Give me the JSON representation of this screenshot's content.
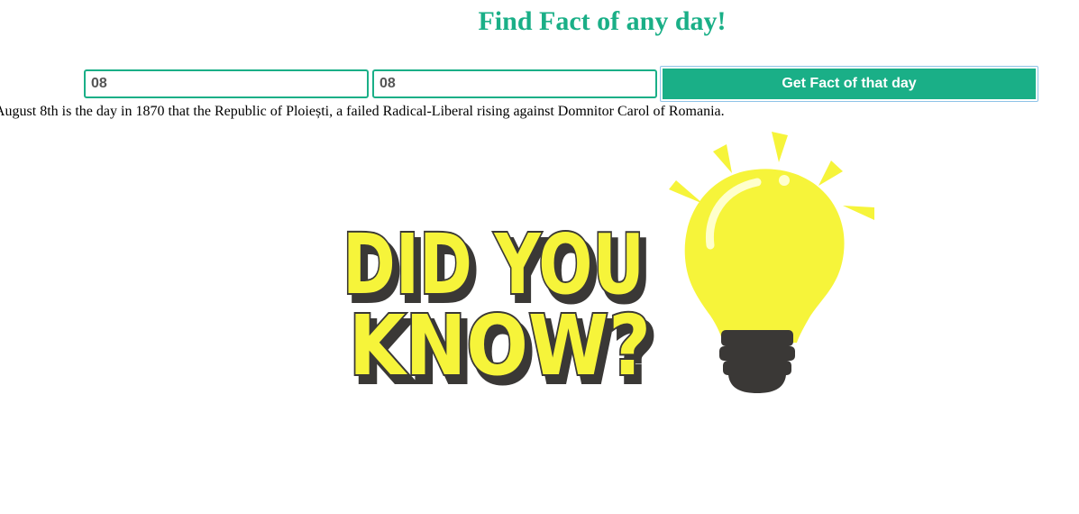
{
  "header": {
    "title": "Find Fact of any day!"
  },
  "form": {
    "day_value": "08",
    "month_value": "08",
    "submit_label": "Get Fact of that day"
  },
  "result": {
    "fact_text": "August 8th is the day in 1870 that the Republic of Ploiești, a failed Radical-Liberal rising against Domnitor Carol of Romania."
  },
  "illustration": {
    "line1": "DID YOU",
    "line2": "KNOW?",
    "icon": "lightbulb-icon"
  },
  "colors": {
    "accent": "#1aaf87",
    "bulb_yellow": "#f6f43a",
    "outline_dark": "#3a3836"
  }
}
